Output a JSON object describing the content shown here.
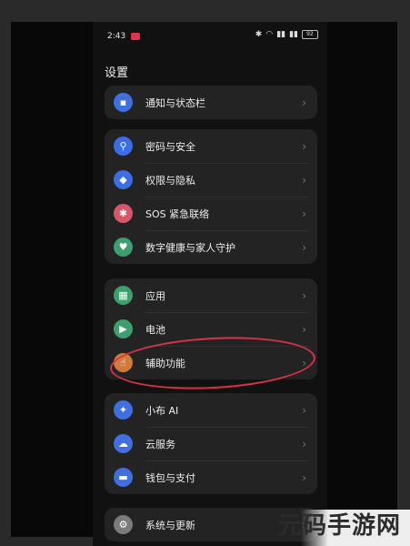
{
  "status": {
    "time": "2:43",
    "battery": "92"
  },
  "page_title": "设置",
  "groups": [
    {
      "items": [
        {
          "label": "通知与状态栏",
          "icon": "notification-icon",
          "color": "#3f6fe0"
        }
      ]
    },
    {
      "items": [
        {
          "label": "密码与安全",
          "icon": "key-icon",
          "color": "#3b6ee6"
        },
        {
          "label": "权限与隐私",
          "icon": "shield-icon",
          "color": "#3b6ee6"
        },
        {
          "label": "SOS 紧急联络",
          "icon": "asterisk-icon",
          "color": "#d9566a"
        },
        {
          "label": "数字健康与家人守护",
          "icon": "family-icon",
          "color": "#3d9f6b"
        }
      ]
    },
    {
      "items": [
        {
          "label": "应用",
          "icon": "apps-grid-icon",
          "color": "#3d9f6b"
        },
        {
          "label": "电池",
          "icon": "battery-icon",
          "color": "#3d9f6b"
        },
        {
          "label": "辅助功能",
          "icon": "hand-icon",
          "color": "#d27a3a"
        }
      ]
    },
    {
      "items": [
        {
          "label": "小布 AI",
          "icon": "assistant-icon",
          "color": "#3f6fe0"
        },
        {
          "label": "云服务",
          "icon": "cloud-icon",
          "color": "#3f6fe0"
        },
        {
          "label": "钱包与支付",
          "icon": "wallet-icon",
          "color": "#3f6fe0"
        }
      ]
    },
    {
      "items": [
        {
          "label": "系统与更新",
          "icon": "gear-icon",
          "color": "#7b7b7b"
        }
      ]
    }
  ],
  "watermark": "元码手游网"
}
